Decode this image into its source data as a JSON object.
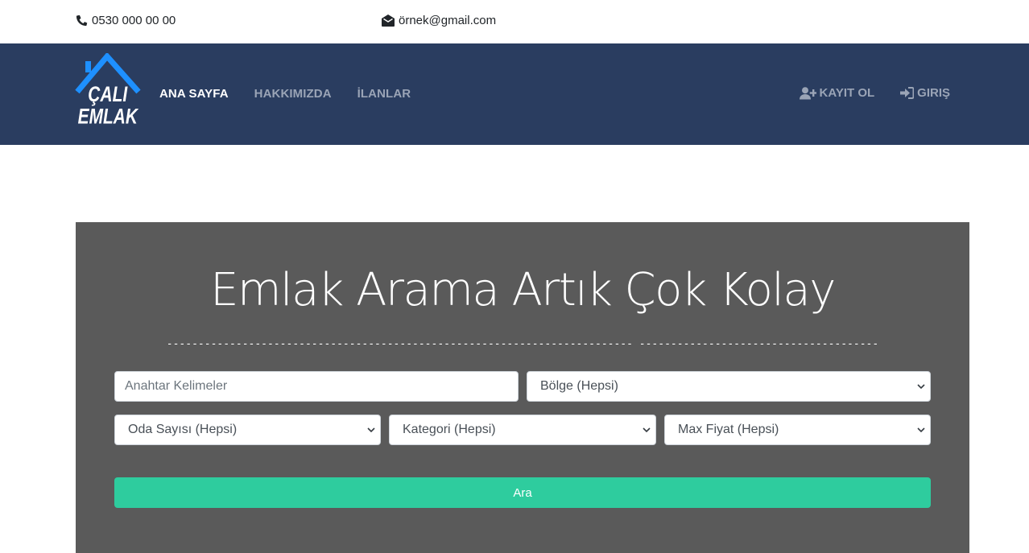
{
  "topbar": {
    "phone": "0530 000 00 00",
    "phone_icon": "phone-icon",
    "email": "örnek@gmail.com",
    "email_icon": "envelope-open-icon"
  },
  "brand": {
    "line1": "ÇALI",
    "line2": "EMLAK",
    "roof_color": "#1e90ff"
  },
  "nav": {
    "items": [
      {
        "label": "ANA SAYFA",
        "active": true
      },
      {
        "label": "HAKKIMIZDA",
        "active": false
      },
      {
        "label": "İLANLAR",
        "active": false
      }
    ],
    "auth": [
      {
        "label": "KAYIT OL",
        "icon": "user-plus-icon"
      },
      {
        "label": "GIRIŞ",
        "icon": "sign-in-icon"
      }
    ]
  },
  "hero": {
    "title": "Emlak Arama Artık Çok Kolay",
    "divider": "-------------------------------------------------------------------------- --------------------------------------"
  },
  "search": {
    "keywords_placeholder": "Anahtar Kelimeler",
    "region": "Bölge (Hepsi)",
    "rooms": "Oda Sayısı (Hepsi)",
    "category": "Kategori (Hepsi)",
    "max_price": "Max Fiyat (Hepsi)",
    "submit": "Ara"
  },
  "colors": {
    "navbar": "#2a3d60",
    "panel": "#5a5a5a",
    "button": "#2ecc9e"
  }
}
